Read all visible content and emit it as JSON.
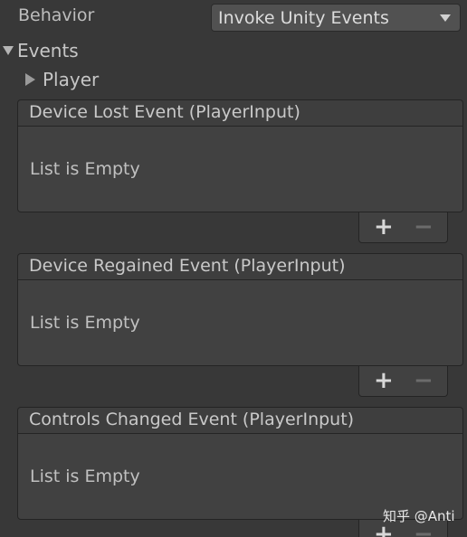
{
  "behavior": {
    "label": "Behavior",
    "selected": "Invoke Unity Events"
  },
  "events_foldout": {
    "label": "Events"
  },
  "player_foldout": {
    "label": "Player"
  },
  "event_panels": [
    {
      "title": "Device Lost Event (PlayerInput)",
      "empty_text": "List is Empty",
      "add": "+",
      "remove": "−"
    },
    {
      "title": "Device Regained Event (PlayerInput)",
      "empty_text": "List is Empty",
      "add": "+",
      "remove": "−"
    },
    {
      "title": "Controls Changed Event (PlayerInput)",
      "empty_text": "List is Empty",
      "add": "+",
      "remove": "−"
    }
  ],
  "watermark": "知乎 @Anti"
}
